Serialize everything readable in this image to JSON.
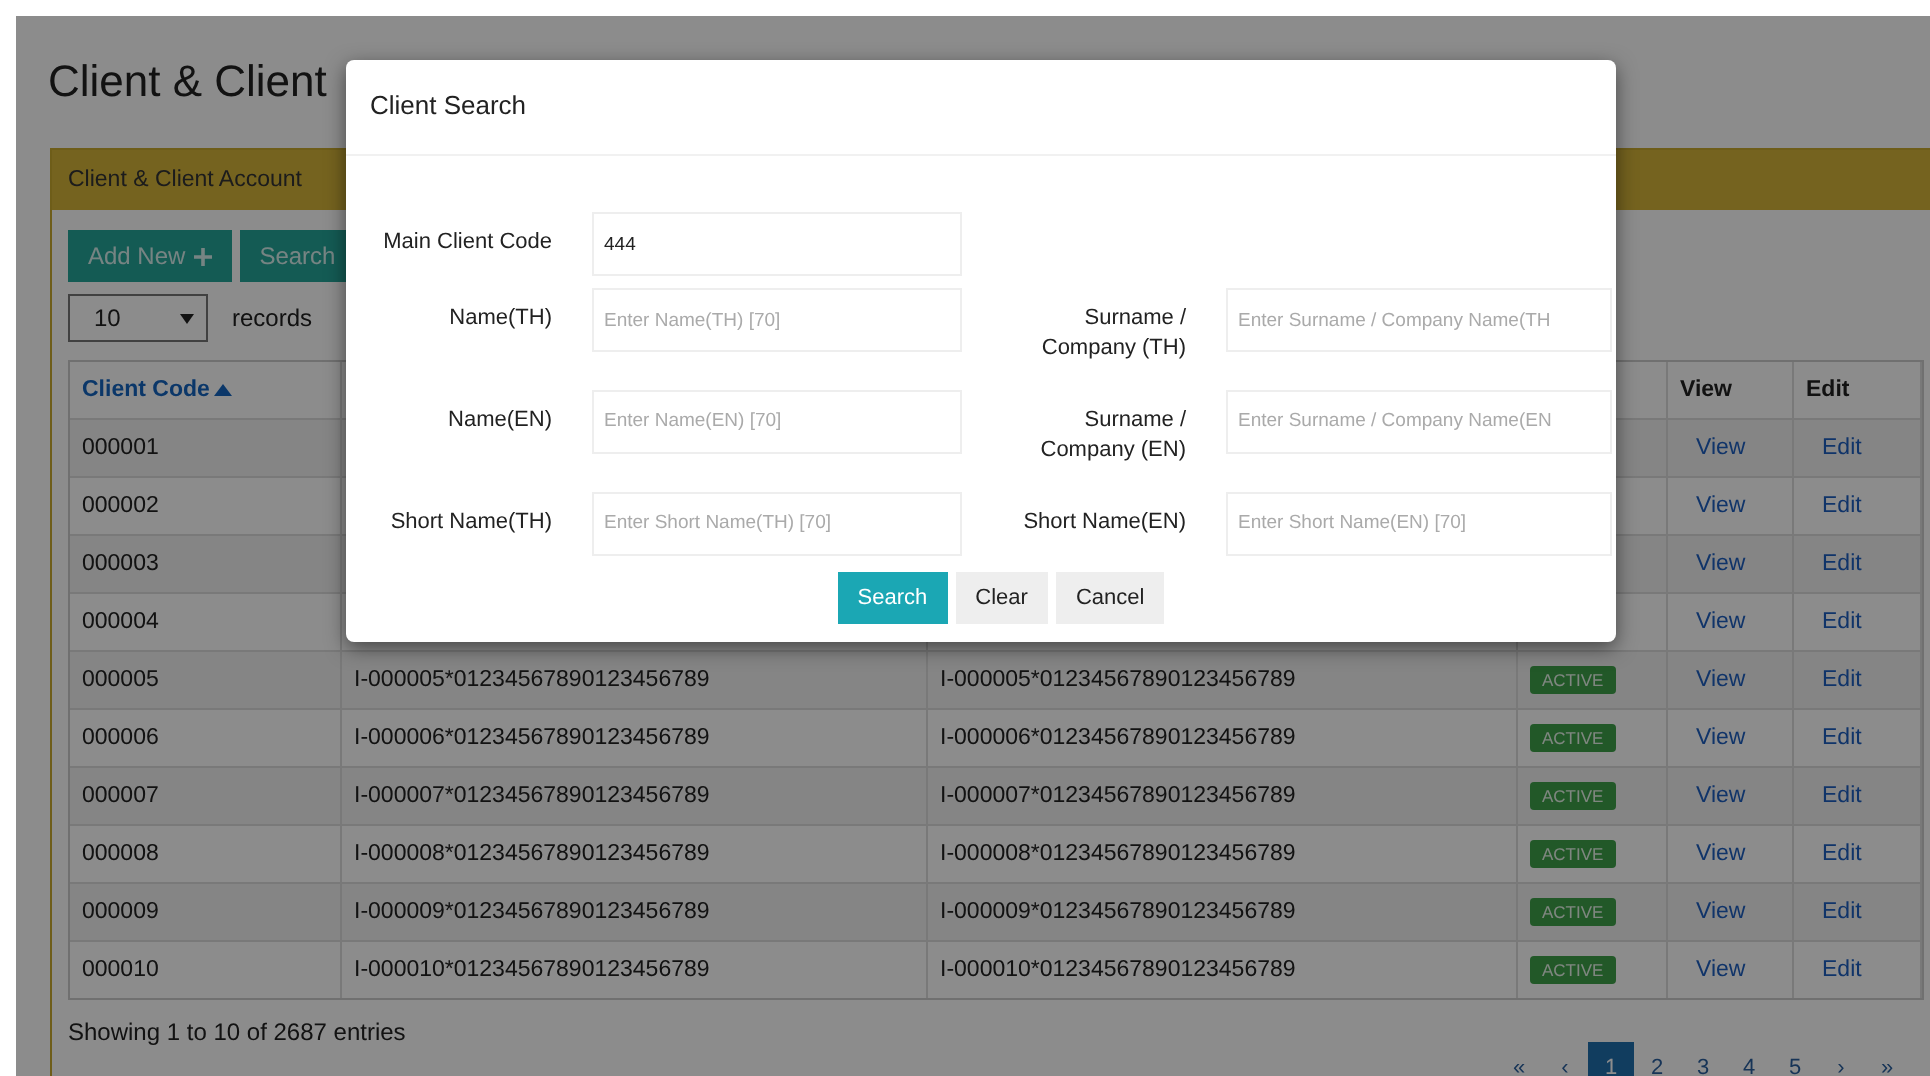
{
  "page": {
    "title": "Client & Client",
    "panel_title": "Client & Client Account"
  },
  "toolbar": {
    "add_button": "Add New",
    "search_button": "Search",
    "page_size": "10",
    "page_size_label": "records"
  },
  "table": {
    "columns": [
      {
        "label": "Client Code",
        "sorted": true
      },
      {
        "label": "View",
        "sorted": false
      },
      {
        "label": "Edit",
        "sorted": false
      }
    ],
    "rows": [
      {
        "code": "000001",
        "view": "View",
        "edit": "Edit"
      },
      {
        "code": "000002",
        "view": "View",
        "edit": "Edit"
      },
      {
        "code": "000003",
        "view": "View",
        "edit": "Edit"
      },
      {
        "code": "000004",
        "view": "View",
        "edit": "Edit"
      },
      {
        "code": "000005",
        "column_2": "I-000005*01234567890123456789",
        "column_3": "I-000005*01234567890123456789",
        "status": "ACTIVE",
        "view": "View",
        "edit": "Edit"
      },
      {
        "code": "000006",
        "column_2": "I-000006*01234567890123456789",
        "column_3": "I-000006*01234567890123456789",
        "status": "ACTIVE",
        "view": "View",
        "edit": "Edit"
      },
      {
        "code": "000007",
        "column_2": "I-000007*01234567890123456789",
        "column_3": "I-000007*01234567890123456789",
        "status": "ACTIVE",
        "view": "View",
        "edit": "Edit"
      },
      {
        "code": "000008",
        "column_2": "I-000008*01234567890123456789",
        "column_3": "I-000008*01234567890123456789",
        "status": "ACTIVE",
        "view": "View",
        "edit": "Edit"
      },
      {
        "code": "000009",
        "column_2": "I-000009*01234567890123456789",
        "column_3": "I-000009*01234567890123456789",
        "status": "ACTIVE",
        "view": "View",
        "edit": "Edit"
      },
      {
        "code": "000010",
        "column_2": "I-000010*01234567890123456789",
        "column_3": "I-000010*01234567890123456789",
        "status": "ACTIVE",
        "view": "View",
        "edit": "Edit"
      }
    ]
  },
  "footer": {
    "info": "Showing 1 to 10 of 2687 entries"
  },
  "pagination": [
    {
      "label": "«",
      "selected": false
    },
    {
      "label": "‹",
      "selected": false
    },
    {
      "label": "1",
      "selected": true
    },
    {
      "label": "2",
      "selected": false
    },
    {
      "label": "3",
      "selected": false
    },
    {
      "label": "4",
      "selected": false
    },
    {
      "label": "5",
      "selected": false
    },
    {
      "label": "›",
      "selected": false
    },
    {
      "label": "»",
      "selected": false
    }
  ],
  "dialog": {
    "title": "Client Search",
    "main_field": {
      "label": "Main Client Code",
      "value": "444"
    },
    "fields": [
      {
        "label": "Name(TH)",
        "placeholder": "Enter Name(TH) [70]"
      },
      {
        "label": "Surname / Company (TH)",
        "placeholder": "Enter Surname / Company Name(TH"
      },
      {
        "label": "Name(EN)",
        "placeholder": "Enter Name(EN) [70]"
      },
      {
        "label": "Surname / Company (EN)",
        "placeholder": "Enter Surname / Company Name(EN"
      },
      {
        "label": "Short Name(TH)",
        "placeholder": "Enter Short Name(TH) [70]"
      },
      {
        "label": "Short Name(EN)",
        "placeholder": "Enter Short Name(EN) [70]"
      }
    ],
    "buttons": [
      {
        "label": "Search",
        "kind": "primary"
      },
      {
        "label": "Clear",
        "kind": "default"
      },
      {
        "label": "Cancel",
        "kind": "default"
      }
    ]
  }
}
